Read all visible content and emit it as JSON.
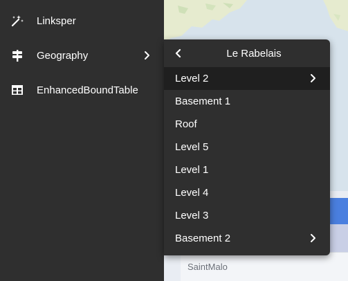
{
  "sidebar": {
    "items": [
      {
        "label": "Linksper",
        "icon": "magic-wand-icon",
        "has_submenu": false
      },
      {
        "label": "Geography",
        "icon": "signpost-icon",
        "has_submenu": true
      },
      {
        "label": "EnhancedBoundTable",
        "icon": "table-icon",
        "has_submenu": false
      }
    ]
  },
  "submenu": {
    "title": "Le Rabelais",
    "back_icon": "chevron-left-icon",
    "items": [
      {
        "label": "Level 2",
        "has_submenu": true,
        "active": true
      },
      {
        "label": "Basement 1",
        "has_submenu": false
      },
      {
        "label": "Roof",
        "has_submenu": false
      },
      {
        "label": "Level 5",
        "has_submenu": false
      },
      {
        "label": "Level 1",
        "has_submenu": false
      },
      {
        "label": "Level 4",
        "has_submenu": false
      },
      {
        "label": "Level 3",
        "has_submenu": false
      },
      {
        "label": "Basement 2",
        "has_submenu": true
      }
    ]
  },
  "table": {
    "row_text": "SaintMalo"
  },
  "colors": {
    "menu_bg": "#2f2f2f",
    "active_item_bg": "#1f1f1f",
    "header_blue": "#4a7fdf",
    "map_water": "#d8e4ee",
    "map_land": "#e8ecd0"
  }
}
